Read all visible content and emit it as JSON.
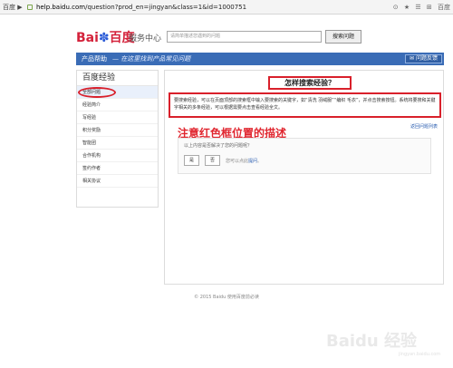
{
  "browser": {
    "tab_tag": "百度 ▶",
    "url_host": "help.baidu.com",
    "url_path": "/question?prod_en=jingyan&class=1&id=1000751",
    "icons": [
      "⊙",
      "★",
      "☰",
      "⊞",
      "百度"
    ]
  },
  "header": {
    "logo_left": "Bai",
    "logo_paw": "du",
    "logo_right": "百度",
    "service_label": "服务中心",
    "search_placeholder": "请简单描述您遇到的问题",
    "search_button": "搜索问题"
  },
  "nav": {
    "home": "产品帮助",
    "slogan": "— 在这里找到产品常见问题",
    "feedback_button": "问题反馈"
  },
  "sidebar": {
    "title": "百度经验",
    "items": [
      {
        "label": "全部问题"
      },
      {
        "label": "经验简介"
      },
      {
        "label": "写经验"
      },
      {
        "label": "积分奖励"
      },
      {
        "label": "智能团"
      },
      {
        "label": "合作机构"
      },
      {
        "label": "签约作者"
      },
      {
        "label": "相关协议"
      }
    ]
  },
  "content": {
    "question_title": "怎样搜索经验？",
    "answer_part1": "要搜索经验，可以在页面顶部的搜索框中输入要搜索的关键字，如“清洗 羽绒服”“编织 毛衣”，并点击搜索按钮。",
    "answer_part2": "系统将要搜和关键字相关的多条经验，可以根据需要点击查看经验全文。",
    "back_link": "返回问题列表",
    "red_note": "注意红色框位置的描述",
    "helpful_question": "以上内容是否解决了您的问题呢？",
    "yes_button": "是",
    "no_button": "否",
    "alt_prefix": "您可以点此",
    "alt_link": "提问",
    "alt_suffix": "。"
  },
  "footer": {
    "text": "© 2015 Baidu 使用百度前必读"
  },
  "watermark": {
    "text": "Baidu 经验",
    "sub": "jingyan.baidu.com"
  },
  "colors": {
    "nav_blue": "#3a6cb6",
    "annotation_red": "#d9202b",
    "link_blue": "#2a5db0"
  }
}
